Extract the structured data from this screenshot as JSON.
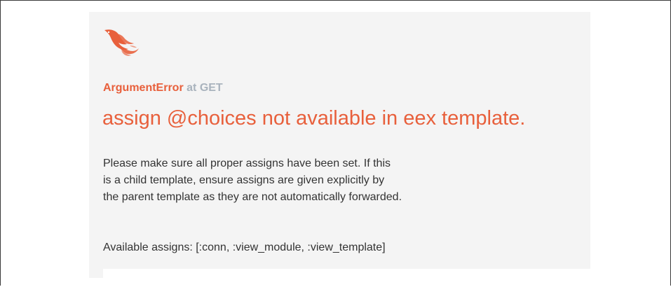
{
  "error": {
    "type": "ArgumentError",
    "at_label": "at GET",
    "title": "assign @choices not available in eex template.",
    "message_lines": [
      "Please make sure all proper assigns have been set. If this",
      "is a child template, ensure assigns are given explicitly by",
      "the parent template as they are not automatically forwarded."
    ],
    "available_assigns": "Available assigns: [:conn, :view_module, :view_template]"
  },
  "logo": {
    "icon": "phoenix-logo-icon",
    "color": "#e8603c"
  },
  "colors": {
    "accent": "#e8603c",
    "muted": "#a9b3bd",
    "text": "#333333",
    "panel_bg": "#f4f4f4"
  }
}
